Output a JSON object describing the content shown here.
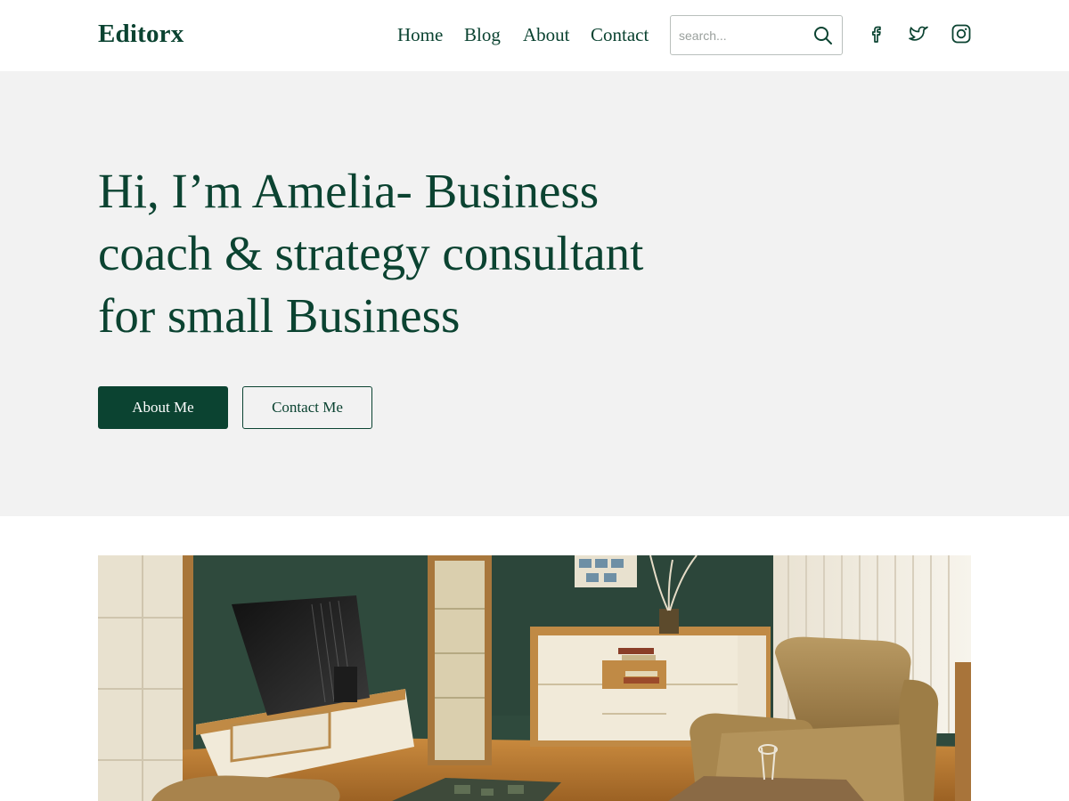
{
  "header": {
    "logo": "Editorx",
    "nav": [
      {
        "label": "Home"
      },
      {
        "label": "Blog"
      },
      {
        "label": "About"
      },
      {
        "label": "Contact"
      }
    ],
    "search": {
      "placeholder": "search...",
      "value": "",
      "icon": "search-icon"
    },
    "social": [
      "facebook-icon",
      "twitter-icon",
      "instagram-icon"
    ]
  },
  "hero": {
    "title_lines": [
      "Hi, I’m Amelia- Business",
      "coach & strategy consultant",
      "for small Business"
    ],
    "primary_button": "About Me",
    "secondary_button": "Contact Me"
  },
  "colors": {
    "brand": "#0b4331",
    "hero_background": "#f2f2f2",
    "page_background": "#ffffff"
  }
}
